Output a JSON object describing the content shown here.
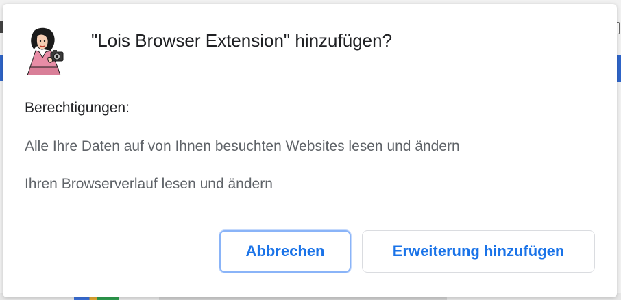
{
  "dialog": {
    "title": "\"Lois Browser Extension\" hinzufügen?",
    "icon": "lois-extension-icon",
    "permissions_heading": "Berechtigungen:",
    "permissions": [
      "Alle Ihre Daten auf von Ihnen besuchten Websites lesen und ändern",
      "Ihren Browserverlauf lesen und ändern"
    ],
    "buttons": {
      "cancel_label": "Abbrechen",
      "add_label": "Erweiterung hinzufügen"
    }
  },
  "colors": {
    "accent": "#1a73e8",
    "focus_ring": "#8ab4f8",
    "title_text": "#202124",
    "secondary_text": "#5f6368"
  }
}
